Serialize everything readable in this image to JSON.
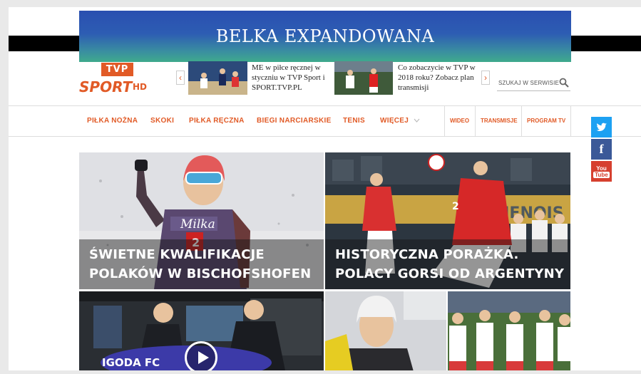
{
  "banner": {
    "text": "BELKA EXPANDOWANA"
  },
  "logo": {
    "tvp": "TVP",
    "sport": "SPORT",
    "hd": "HD"
  },
  "news": [
    {
      "text": "ME w piłce ręcznej w styczniu w TVP Sport i SPORT.TVP.PL"
    },
    {
      "text": "Co zobaczycie w TVP w 2018 roku? Zobacz plan transmisji"
    }
  ],
  "carousel": {
    "prev_icon": "chevron-left-icon",
    "next_icon": "chevron-right-icon",
    "prev_glyph": "‹",
    "next_glyph": "›"
  },
  "search": {
    "placeholder": "SZUKAJ W SERWISIE",
    "icon": "search-icon"
  },
  "nav": {
    "items": [
      "PIŁKA NOŻNA",
      "SKOKI",
      "PIŁKA RĘCZNA",
      "BIEGI NARCIARSKIE",
      "TENIS",
      "WIĘCEJ"
    ],
    "more_icon": "chevron-down-icon",
    "right_items": [
      "WIDEO",
      "TRANSMISJE",
      "PROGRAM TV"
    ]
  },
  "social": {
    "twitter_icon": "twitter-icon",
    "facebook": "f",
    "youtube_you": "You",
    "youtube_tube": "Tube"
  },
  "tiles": [
    {
      "line1": "ŚWIETNE KWALIFIKACJE",
      "line2": "POLAKÓW W BISCHOFSHOFEN",
      "bib": "2",
      "sponsor": "Milka"
    },
    {
      "line1": "HISTORYCZNA PORAŻKA.",
      "line2": "POLACY GORSI OD ARGENTYNY",
      "jersey": "2"
    }
  ],
  "bottom_tiles": {
    "club_text": "IGODA FC"
  },
  "colors": {
    "accent": "#e15a26",
    "twitter": "#1da1f2",
    "facebook": "#3b5998",
    "youtube": "#d6402f"
  }
}
